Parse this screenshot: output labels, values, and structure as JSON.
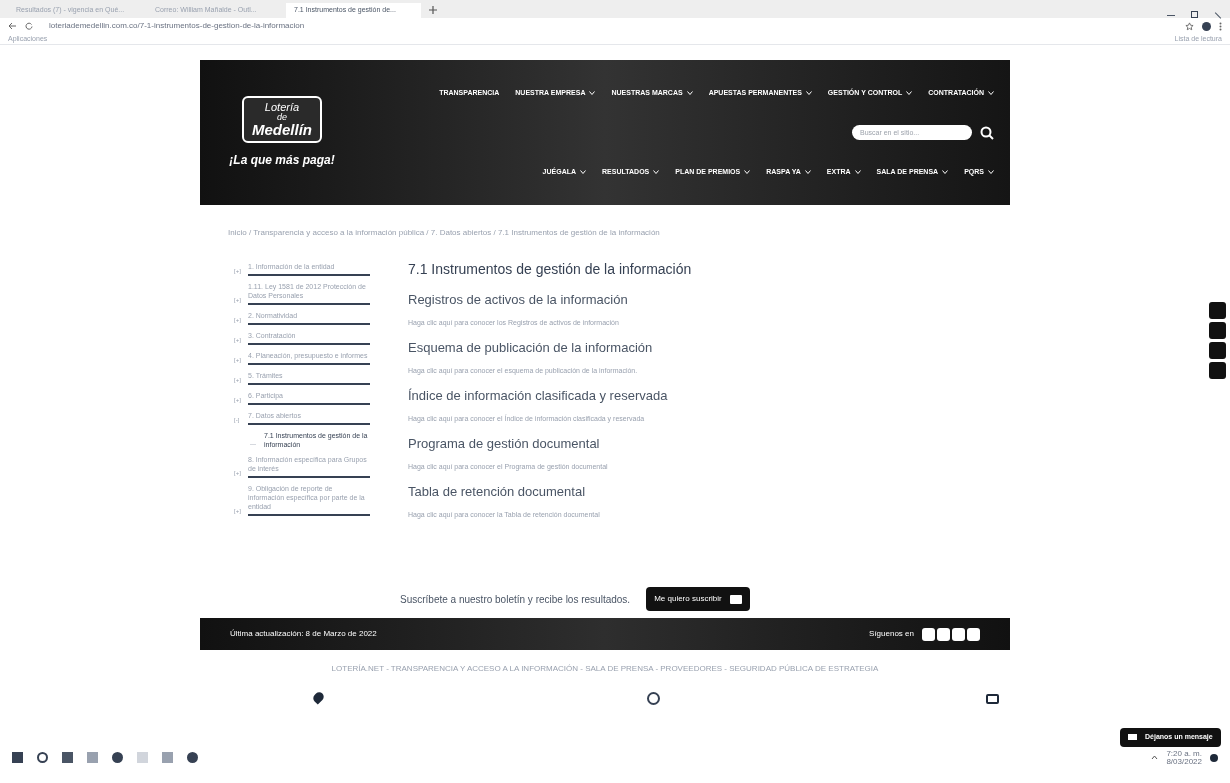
{
  "browser": {
    "tabs": [
      {
        "label": "Resultados (7) - vigencia en Qué...",
        "selected": false
      },
      {
        "label": "Correo: William Mañalde - Outl...",
        "selected": false
      },
      {
        "label": "7.1 Instrumentos de gestión de...",
        "selected": true
      }
    ],
    "address": "loteriademedellin.com.co/7-1-instrumentos-de-gestion-de-la-informacion",
    "bookmarks_left": "Aplicaciones",
    "bookmarks_right": "Lista de lectura"
  },
  "header": {
    "logo_top": "Lotería",
    "logo_mid": "de",
    "logo_name": "Medellín",
    "slogan": "¡La que más paga!",
    "nav_top": [
      "TRANSPARENCIA",
      "NUESTRA EMPRESA",
      "NUESTRAS MARCAS",
      "APUESTAS PERMANENTES",
      "GESTIÓN Y CONTROL",
      "CONTRATACIÓN"
    ],
    "nav_top_dropdown": [
      false,
      true,
      true,
      true,
      true,
      true
    ],
    "search_placeholder": "Buscar en el sitio...",
    "nav_bottom": [
      "JUÉGALA",
      "RESULTADOS",
      "PLAN DE PREMIOS",
      "RASPA YA",
      "EXTRA",
      "SALA DE PRENSA",
      "PQRS"
    ]
  },
  "breadcrumb": "Inicio / Transparencia y acceso a la información pública / 7. Datos abiertos / 7.1 Instrumentos de gestión de la información",
  "sidebar": [
    {
      "marker": "[+]",
      "label": "1. Información de la entidad"
    },
    {
      "marker": "[+]",
      "label": "1.11. Ley 1581 de 2012 Protección de Datos Personales"
    },
    {
      "marker": "[+]",
      "label": "2. Normatividad"
    },
    {
      "marker": "[+]",
      "label": "3. Contratación"
    },
    {
      "marker": "[+]",
      "label": "4. Planeación, presupuesto e informes"
    },
    {
      "marker": "[+]",
      "label": "5. Trámites"
    },
    {
      "marker": "[+]",
      "label": "6. Participa"
    },
    {
      "marker": "[-]",
      "label": "7. Datos abiertos",
      "children": [
        {
          "marker": "—",
          "label": "7.1 Instrumentos de gestión de la información",
          "selected": true
        }
      ]
    },
    {
      "marker": "[+]",
      "label": "8. Información específica para Grupos de interés"
    },
    {
      "marker": "[+]",
      "label": "9. Obligación de reporte de información específica por parte de la entidad"
    }
  ],
  "content": {
    "title": "7.1 Instrumentos de gestión de la información",
    "sections": [
      {
        "heading": "Registros de activos de la información",
        "link": "Haga clic aquí para conocer los Registros de activos de información"
      },
      {
        "heading": "Esquema de publicación de la información",
        "link": "Haga clic aquí para conocer el esquema de publicación de la información."
      },
      {
        "heading": "Índice de información clasificada y reservada",
        "link": "Haga clic aquí para conocer el Índice de información clasificada y reservada"
      },
      {
        "heading": "Programa de gestión documental",
        "link": "Haga clic aquí para conocer el Programa de gestión documental"
      },
      {
        "heading": "Tabla de retención documental",
        "link": "Haga clic aquí para conocer la Tabla de retención documental"
      }
    ]
  },
  "subscribe": {
    "text": "Suscríbete a nuestro boletín y recibe los resultados.",
    "button": "Me quiero suscribir"
  },
  "footer": {
    "updated": "Última actualización: 8 de Marzo de 2022",
    "follow": "Síguenos en",
    "links": "LOTERÍA.NET  -  TRANSPARENCIA Y ACCESO A LA INFORMACIÓN  -  SALA DE PRENSA  -  PROVEEDORES  -  SEGURIDAD PÚBLICA DE ESTRATEGIA"
  },
  "chat_button": "Déjanos un mensaje",
  "taskbar": {
    "time": "7:20 a. m.",
    "date": "8/03/2022"
  }
}
